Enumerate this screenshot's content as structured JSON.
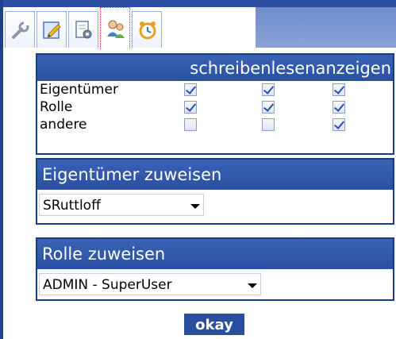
{
  "tabs": [
    {
      "icon": "wrench-icon"
    },
    {
      "icon": "edit-pencil-icon"
    },
    {
      "icon": "page-settings-icon"
    },
    {
      "icon": "users-icon",
      "active": true
    },
    {
      "icon": "alarm-clock-icon"
    }
  ],
  "permissions": {
    "columns": [
      "schreiben",
      "lesen",
      "anzeigen"
    ],
    "rows": [
      {
        "label": "Eigentümer",
        "checked": [
          true,
          true,
          true
        ]
      },
      {
        "label": "Rolle",
        "checked": [
          true,
          true,
          true
        ]
      },
      {
        "label": "andere",
        "checked": [
          false,
          false,
          true
        ]
      }
    ]
  },
  "owner": {
    "title": "Eigentümer zuweisen",
    "selected": "SRuttloff"
  },
  "role": {
    "title": "Rolle zuweisen",
    "selected": "ADMIN - SuperUser"
  },
  "okay_label": "okay",
  "colors": {
    "header_blue": "#2b50a3",
    "border_blue": "#173d91",
    "active_tab_border": "#cc3333"
  }
}
